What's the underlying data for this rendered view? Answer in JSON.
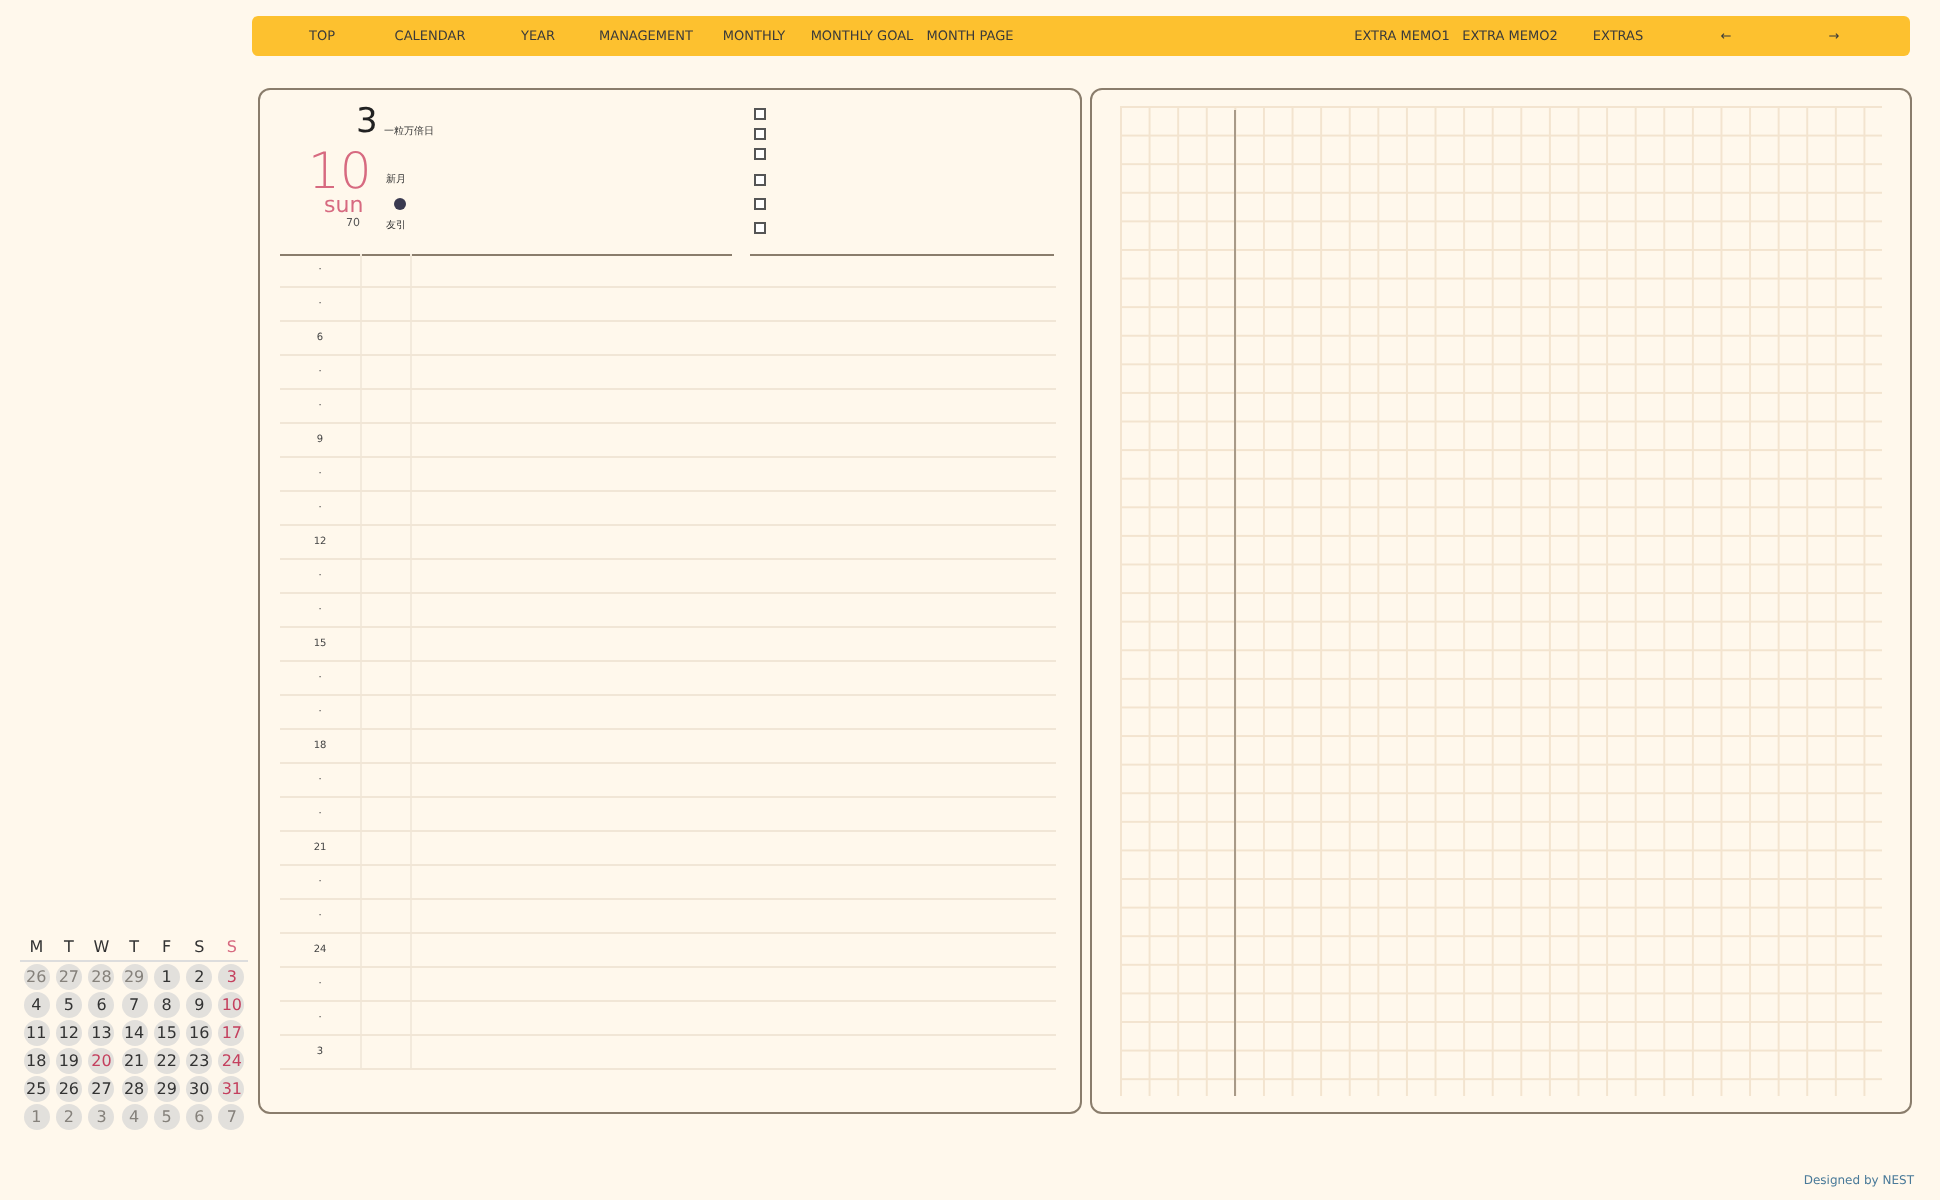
{
  "nav": {
    "left": [
      "TOP",
      "CALENDAR",
      "YEAR",
      "MANAGEMENT",
      "MONTHLY",
      "MONTHLY GOAL",
      "MONTH PAGE"
    ],
    "right": [
      "EXTRA MEMO1",
      "EXTRA MEMO2",
      "EXTRAS",
      "←",
      "→"
    ]
  },
  "day": {
    "month": "3",
    "lucky_day": "一粒万倍日",
    "date": "10",
    "weekday": "sun",
    "day_of_year": "70",
    "moon_phase": "新月",
    "rokuyo": "友引"
  },
  "todo_checkboxes": [
    {
      "checked": false
    },
    {
      "checked": false
    },
    {
      "checked": false
    },
    {
      "checked": false
    },
    {
      "checked": false
    },
    {
      "checked": false
    }
  ],
  "hour_rows": [
    "·",
    "·",
    "6",
    "·",
    "·",
    "9",
    "·",
    "·",
    "12",
    "·",
    "·",
    "15",
    "·",
    "·",
    "18",
    "·",
    "·",
    "21",
    "·",
    "·",
    "24",
    "·",
    "·",
    "3"
  ],
  "mini_calendar": {
    "weekdays": [
      {
        "label": "M",
        "kind": "weekday"
      },
      {
        "label": "T",
        "kind": "weekday"
      },
      {
        "label": "W",
        "kind": "weekday"
      },
      {
        "label": "T",
        "kind": "weekday"
      },
      {
        "label": "F",
        "kind": "weekday"
      },
      {
        "label": "S",
        "kind": "weekday"
      },
      {
        "label": "S",
        "kind": "sunday"
      }
    ],
    "days": [
      {
        "label": "26",
        "kind": "other"
      },
      {
        "label": "27",
        "kind": "other"
      },
      {
        "label": "28",
        "kind": "other"
      },
      {
        "label": "29",
        "kind": "other"
      },
      {
        "label": "1",
        "kind": "normal"
      },
      {
        "label": "2",
        "kind": "normal"
      },
      {
        "label": "3",
        "kind": "holiday"
      },
      {
        "label": "4",
        "kind": "normal"
      },
      {
        "label": "5",
        "kind": "normal"
      },
      {
        "label": "6",
        "kind": "normal"
      },
      {
        "label": "7",
        "kind": "normal"
      },
      {
        "label": "8",
        "kind": "normal"
      },
      {
        "label": "9",
        "kind": "normal"
      },
      {
        "label": "10",
        "kind": "holiday"
      },
      {
        "label": "11",
        "kind": "normal"
      },
      {
        "label": "12",
        "kind": "normal"
      },
      {
        "label": "13",
        "kind": "normal"
      },
      {
        "label": "14",
        "kind": "normal"
      },
      {
        "label": "15",
        "kind": "normal"
      },
      {
        "label": "16",
        "kind": "normal"
      },
      {
        "label": "17",
        "kind": "holiday"
      },
      {
        "label": "18",
        "kind": "normal"
      },
      {
        "label": "19",
        "kind": "normal"
      },
      {
        "label": "20",
        "kind": "holiday"
      },
      {
        "label": "21",
        "kind": "normal"
      },
      {
        "label": "22",
        "kind": "normal"
      },
      {
        "label": "23",
        "kind": "normal"
      },
      {
        "label": "24",
        "kind": "holiday"
      },
      {
        "label": "25",
        "kind": "normal"
      },
      {
        "label": "26",
        "kind": "normal"
      },
      {
        "label": "27",
        "kind": "normal"
      },
      {
        "label": "28",
        "kind": "normal"
      },
      {
        "label": "29",
        "kind": "normal"
      },
      {
        "label": "30",
        "kind": "normal"
      },
      {
        "label": "31",
        "kind": "holiday"
      },
      {
        "label": "1",
        "kind": "other"
      },
      {
        "label": "2",
        "kind": "other"
      },
      {
        "label": "3",
        "kind": "other"
      },
      {
        "label": "4",
        "kind": "other"
      },
      {
        "label": "5",
        "kind": "other"
      },
      {
        "label": "6",
        "kind": "other"
      },
      {
        "label": "7",
        "kind": "other"
      }
    ]
  },
  "footer": "Designed by NEST"
}
